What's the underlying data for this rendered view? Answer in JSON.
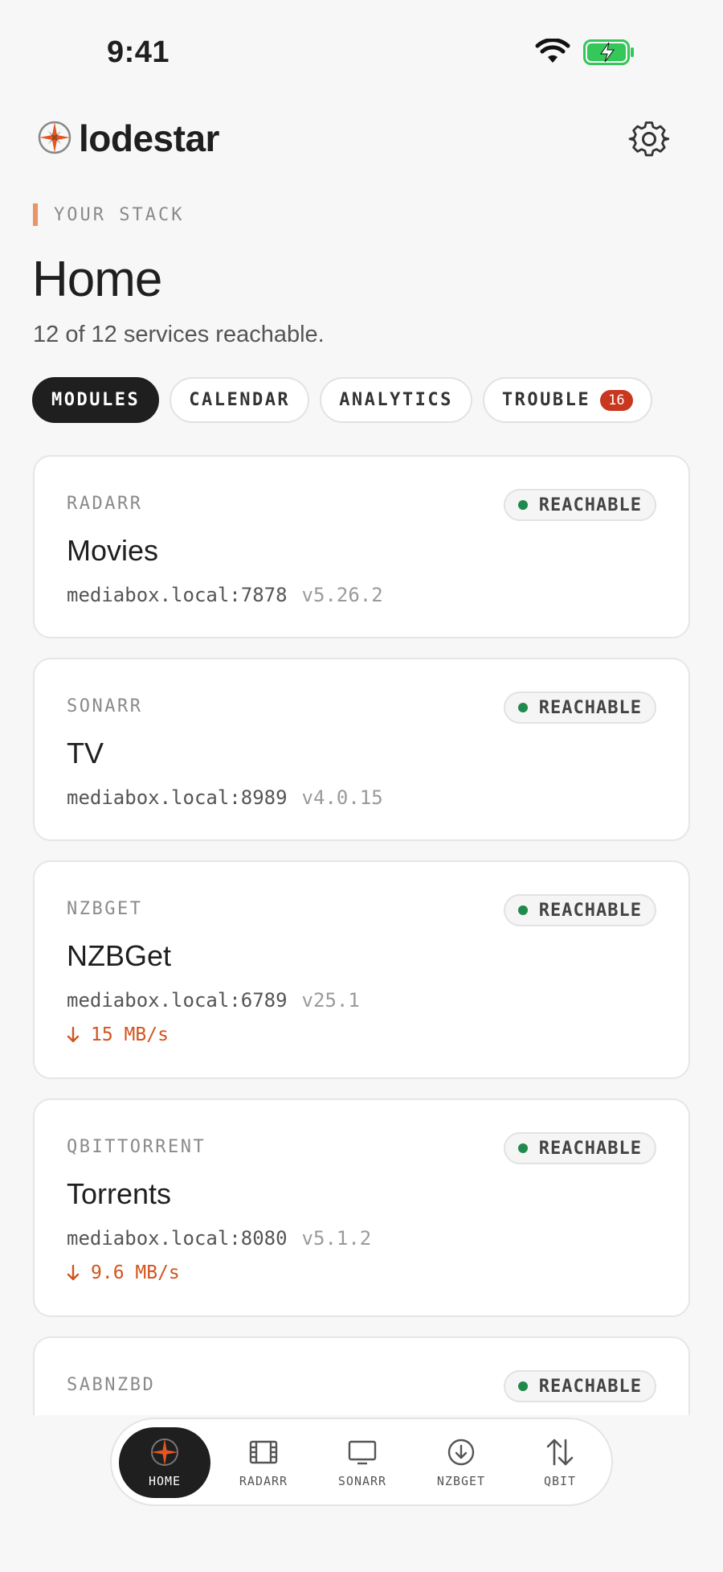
{
  "status_bar": {
    "time": "9:41"
  },
  "app": {
    "name": "lodestar",
    "brand_color": "#e4561f"
  },
  "header": {
    "eyebrow": "YOUR STACK",
    "title": "Home",
    "subtitle": "12 of 12 services reachable."
  },
  "tabs": [
    {
      "label": "MODULES",
      "active": true
    },
    {
      "label": "CALENDAR",
      "active": false
    },
    {
      "label": "ANALYTICS",
      "active": false
    },
    {
      "label": "TROUBLE",
      "active": false,
      "badge": "16"
    }
  ],
  "services": [
    {
      "kind": "RADARR",
      "name": "Movies",
      "host": "mediabox.local:7878",
      "version": "v5.26.2",
      "status": "REACHABLE"
    },
    {
      "kind": "SONARR",
      "name": "TV",
      "host": "mediabox.local:8989",
      "version": "v4.0.15",
      "status": "REACHABLE"
    },
    {
      "kind": "NZBGET",
      "name": "NZBGet",
      "host": "mediabox.local:6789",
      "version": "v25.1",
      "status": "REACHABLE",
      "speed": "15 MB/s"
    },
    {
      "kind": "QBITTORRENT",
      "name": "Torrents",
      "host": "mediabox.local:8080",
      "version": "v5.1.2",
      "status": "REACHABLE",
      "speed": "9.6 MB/s"
    },
    {
      "kind": "SABNZBD",
      "status": "REACHABLE"
    }
  ],
  "nav": [
    {
      "label": "HOME",
      "icon": "compass-star-icon",
      "active": true
    },
    {
      "label": "RADARR",
      "icon": "film-icon",
      "active": false
    },
    {
      "label": "SONARR",
      "icon": "tv-icon",
      "active": false
    },
    {
      "label": "NZBGET",
      "icon": "download-circle-icon",
      "active": false
    },
    {
      "label": "QBIT",
      "icon": "up-down-arrows-icon",
      "active": false
    }
  ],
  "colors": {
    "reachable": "#1f8a4c",
    "speed": "#d2541e",
    "badge": "#c8371f",
    "accent": "#e99566"
  }
}
